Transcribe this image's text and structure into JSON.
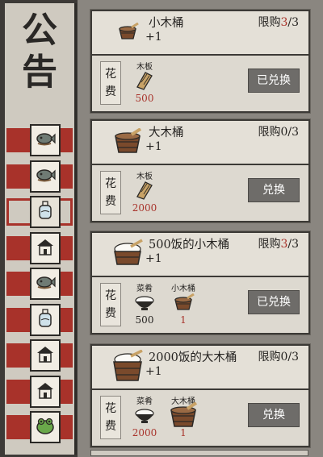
{
  "notice": {
    "title": "公\n告"
  },
  "tabs": [
    {
      "icon": "fish-icon",
      "selected": false
    },
    {
      "icon": "fish-icon",
      "selected": false
    },
    {
      "icon": "bottle-icon",
      "selected": true
    },
    {
      "icon": "house-icon",
      "selected": false
    },
    {
      "icon": "fish-icon",
      "selected": false
    },
    {
      "icon": "bottle-icon",
      "selected": false
    },
    {
      "icon": "house-icon",
      "selected": false
    },
    {
      "icon": "house-icon",
      "selected": false
    },
    {
      "icon": "frog-icon",
      "selected": false
    }
  ],
  "cost_label": "花\n费",
  "cards": [
    {
      "name": "小木桶",
      "plus": "+1",
      "limit_prefix": "限购",
      "limit_cur": "3",
      "limit_rest": "/3",
      "limit_cur_red": true,
      "thumb": "small-bucket-icon",
      "costs": [
        {
          "name": "木板",
          "icon": "plank-icon",
          "amount": "500",
          "red": true
        }
      ],
      "button": "已兑换"
    },
    {
      "name": "大木桶",
      "plus": "+1",
      "limit_prefix": "限购",
      "limit_cur": "0",
      "limit_rest": "/3",
      "limit_cur_red": false,
      "thumb": "big-bucket-icon",
      "costs": [
        {
          "name": "木板",
          "icon": "plank-icon",
          "amount": "2000",
          "red": true
        }
      ],
      "button": "兑换"
    },
    {
      "name": "500饭的小木桶",
      "plus": "+1",
      "limit_prefix": "限购",
      "limit_cur": "3",
      "limit_rest": "/3",
      "limit_cur_red": true,
      "thumb": "rice-small-bucket-icon",
      "costs": [
        {
          "name": "菜肴",
          "icon": "rice-bowl-icon",
          "amount": "500",
          "red": false
        },
        {
          "name": "小木桶",
          "icon": "small-bucket-icon",
          "amount": "1",
          "red": true
        }
      ],
      "button": "已兑换"
    },
    {
      "name": "2000饭的大木桶",
      "plus": "+1",
      "limit_prefix": "限购",
      "limit_cur": "0",
      "limit_rest": "/3",
      "limit_cur_red": false,
      "thumb": "rice-big-bucket-icon",
      "costs": [
        {
          "name": "菜肴",
          "icon": "rice-bowl-icon",
          "amount": "2000",
          "red": true
        },
        {
          "name": "大木桶",
          "icon": "big-bucket-icon",
          "amount": "1",
          "red": true
        }
      ],
      "button": "兑换"
    }
  ],
  "colors": {
    "accent_red": "#a8322a",
    "button_bg": "#6e6c69",
    "panel": "#ddd9d0"
  }
}
